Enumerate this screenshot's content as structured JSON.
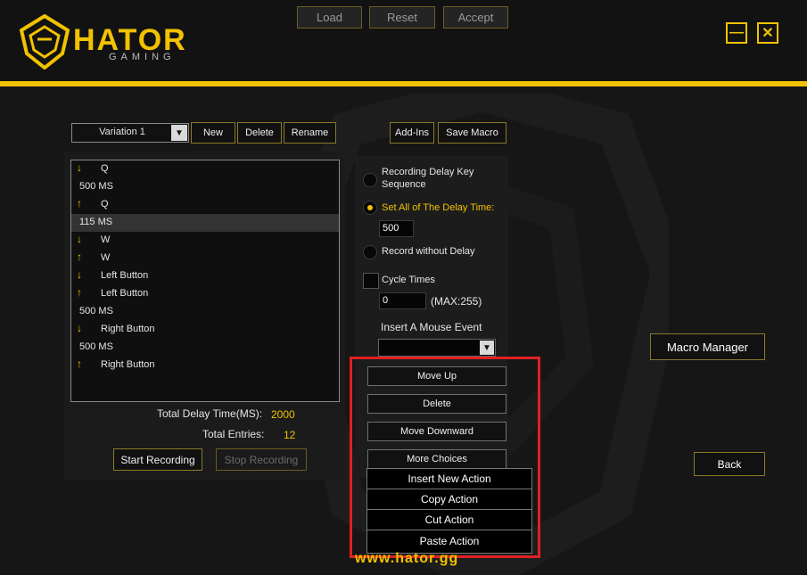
{
  "app": {
    "logo_text": "HATOR",
    "logo_sub": "GAMING",
    "footer_url": "www.hator.gg"
  },
  "top_buttons": {
    "load": "Load",
    "reset": "Reset",
    "accept": "Accept"
  },
  "window_controls": {
    "minimize": "—",
    "close": "✕"
  },
  "left_toolbar": {
    "variation": "Variation 1",
    "new": "New",
    "delete": "Delete",
    "rename": "Rename"
  },
  "right_toolbar": {
    "add_ins": "Add-Ins",
    "save_macro": "Save Macro"
  },
  "macro_list": [
    {
      "icon": "arrow-down-icon",
      "text": "Q",
      "type": "key"
    },
    {
      "icon": "",
      "text": "500 MS",
      "type": "delay"
    },
    {
      "icon": "arrow-up-icon",
      "text": "Q",
      "type": "key"
    },
    {
      "icon": "",
      "text": "115 MS",
      "type": "delay",
      "selected": true
    },
    {
      "icon": "arrow-down-icon",
      "text": "W",
      "type": "key"
    },
    {
      "icon": "arrow-up-icon",
      "text": "W",
      "type": "key"
    },
    {
      "icon": "arrow-down-icon",
      "text": "Left Button",
      "type": "key"
    },
    {
      "icon": "arrow-up-icon",
      "text": "Left Button",
      "type": "key"
    },
    {
      "icon": "",
      "text": "500 MS",
      "type": "delay"
    },
    {
      "icon": "arrow-down-icon",
      "text": "Right Button",
      "type": "key"
    },
    {
      "icon": "",
      "text": "500 MS",
      "type": "delay"
    },
    {
      "icon": "arrow-up-icon",
      "text": "Right Button",
      "type": "key"
    }
  ],
  "stats": {
    "total_delay_label": "Total Delay Time(MS):",
    "total_delay_value": "2000",
    "total_entries_label": "Total Entries:",
    "total_entries_value": "12"
  },
  "recording": {
    "start": "Start Recording",
    "stop": "Stop Recording"
  },
  "options": {
    "recording_delay": "Recording Delay Key Sequence",
    "set_all_delay": "Set All of The Delay Time:",
    "set_all_delay_value": "500",
    "record_without_delay": "Record without Delay",
    "cycle_times": "Cycle Times",
    "cycle_value": "0",
    "cycle_max": "(MAX:255)",
    "insert_mouse_event": "Insert A Mouse Event",
    "mouse_event_value": ""
  },
  "actions": {
    "move_up": "Move Up",
    "delete": "Delete",
    "move_down": "Move Downward",
    "more_choices": "More Choices"
  },
  "context_menu": [
    "Insert New Action",
    "Copy Action",
    "Cut Action",
    "Paste Action"
  ],
  "side_buttons": {
    "macro_manager": "Macro Manager",
    "back": "Back"
  },
  "colors": {
    "accent": "#f2c200",
    "highlight_box": "#e02020",
    "background": "#161616"
  }
}
